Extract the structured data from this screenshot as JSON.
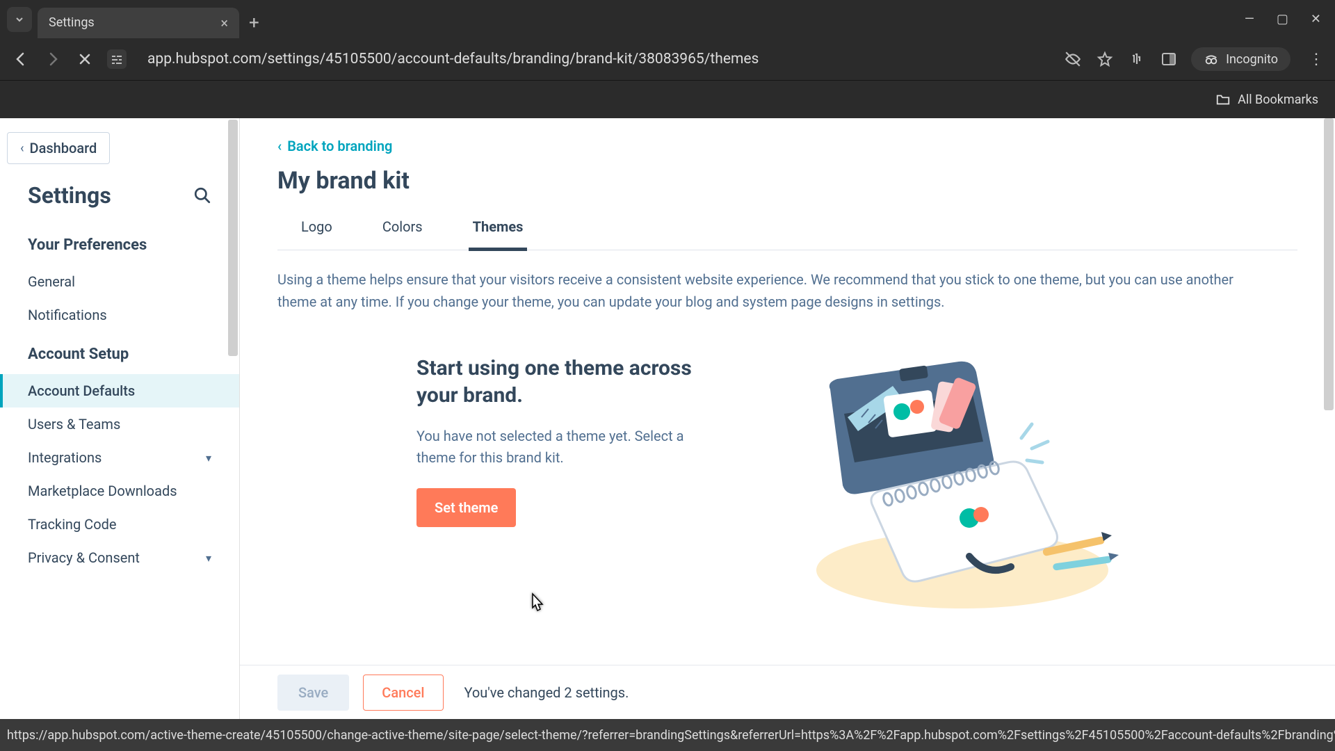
{
  "browser": {
    "tab_title": "Settings",
    "url": "app.hubspot.com/settings/45105500/account-defaults/branding/brand-kit/38083965/themes",
    "incognito_label": "Incognito",
    "all_bookmarks": "All Bookmarks"
  },
  "sidebar": {
    "dashboard": "Dashboard",
    "settings_title": "Settings",
    "section_preferences": "Your Preferences",
    "nav_general": "General",
    "nav_notifications": "Notifications",
    "section_account_setup": "Account Setup",
    "nav_account_defaults": "Account Defaults",
    "nav_users_teams": "Users & Teams",
    "nav_integrations": "Integrations",
    "nav_marketplace": "Marketplace Downloads",
    "nav_tracking": "Tracking Code",
    "nav_privacy": "Privacy & Consent"
  },
  "main": {
    "back_link": "Back to branding",
    "page_title": "My brand kit",
    "tab_logo": "Logo",
    "tab_colors": "Colors",
    "tab_themes": "Themes",
    "description": "Using a theme helps ensure that your visitors receive a consistent website experience. We recommend that you stick to one theme, but you can use another theme at any time. If you change your theme, you can update your blog and system page designs in settings.",
    "card_heading": "Start using one theme across your brand.",
    "card_body": "You have not selected a theme yet. Select a theme for this brand kit.",
    "set_theme_button": "Set theme"
  },
  "footer": {
    "save": "Save",
    "cancel": "Cancel",
    "changes_message": "You've changed 2 settings."
  },
  "status_url": "https://app.hubspot.com/active-theme-create/45105500/change-active-theme/site-page/select-theme/?referrer=brandingSettings&referrerUrl=https%3A%2F%2Fapp.hubspot.com%2Fsettings%2F45105500%2Faccount-defaults%2Fbranding%2Fbra..."
}
